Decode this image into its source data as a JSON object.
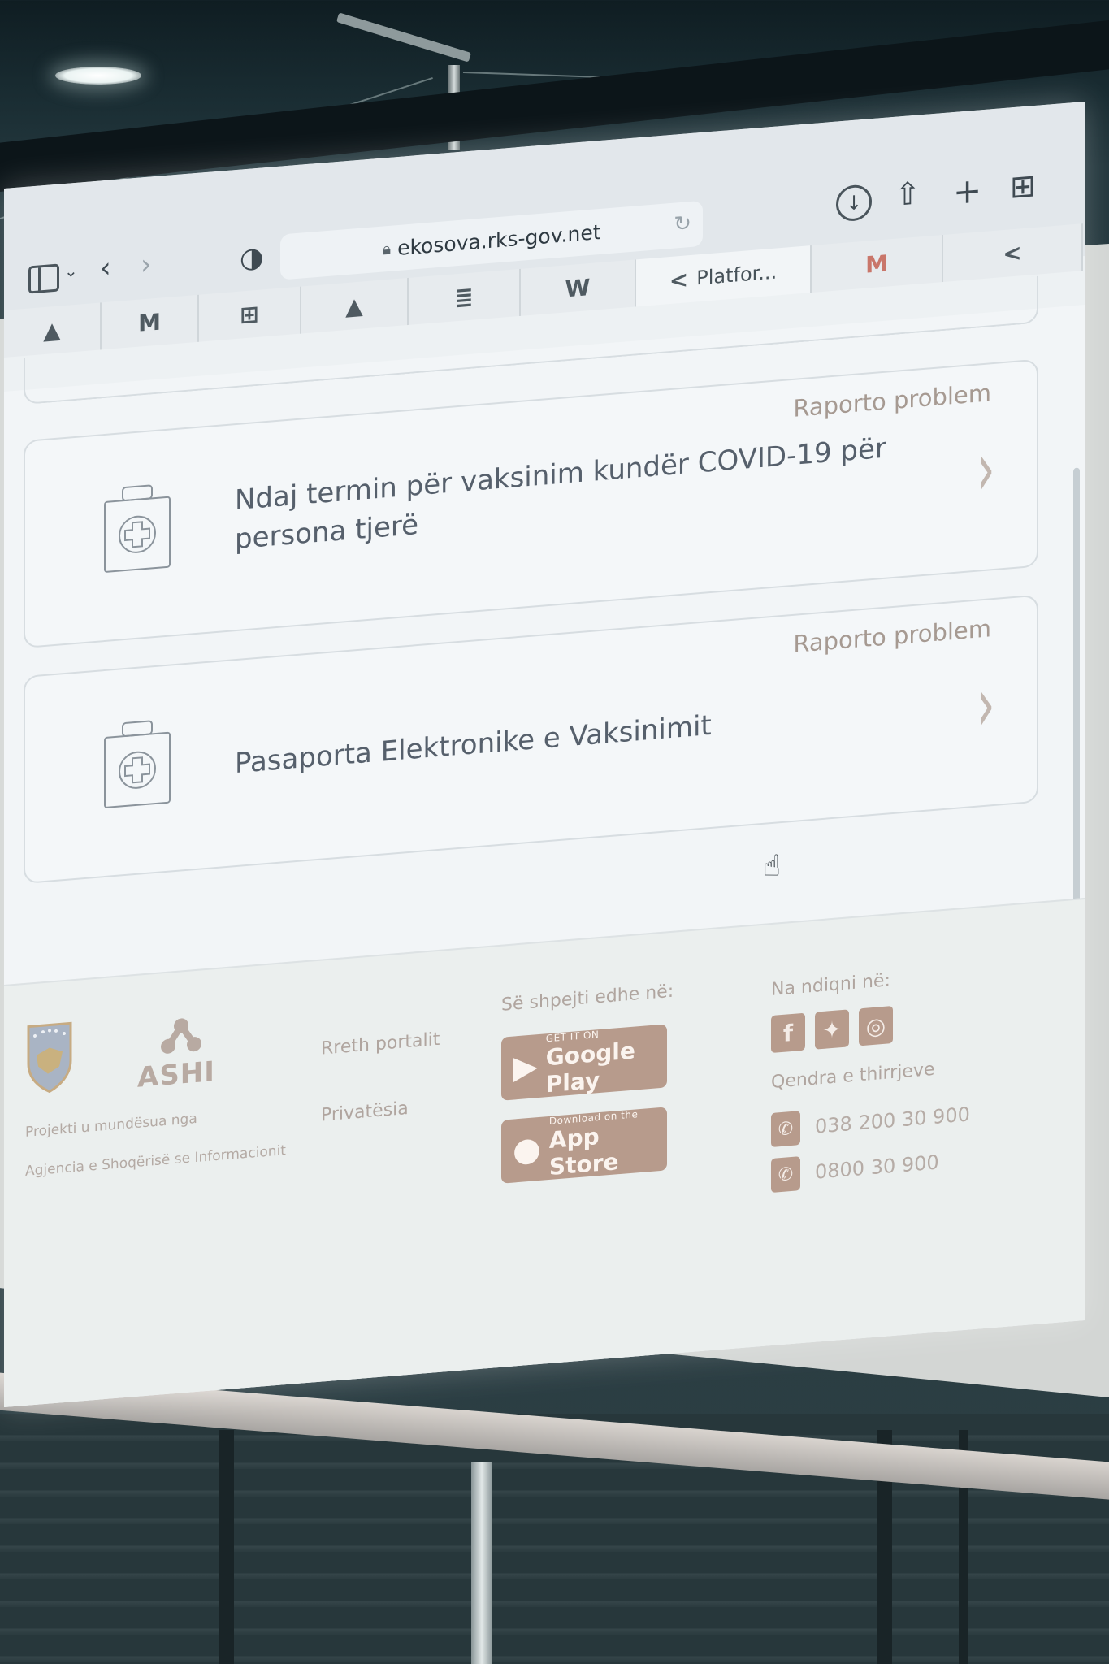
{
  "browser": {
    "url": "ekosova.rks-gov.net",
    "tabs": [
      {
        "icon": "google-drive-icon",
        "glyph": "▲",
        "label": ""
      },
      {
        "icon": "gmail-icon",
        "glyph": "M",
        "label": ""
      },
      {
        "icon": "calculator-icon",
        "glyph": "⊞",
        "label": ""
      },
      {
        "icon": "google-drive-icon",
        "glyph": "▲",
        "label": ""
      },
      {
        "icon": "google-docs-icon",
        "glyph": "≣",
        "label": ""
      },
      {
        "icon": "wordpress-icon",
        "glyph": "W",
        "label": ""
      },
      {
        "icon": "share-node-icon",
        "glyph": "<",
        "label": "Platfor..."
      },
      {
        "icon": "gmail-icon",
        "glyph": "M",
        "label": ""
      },
      {
        "icon": "share-node-icon",
        "glyph": "<",
        "label": ""
      }
    ]
  },
  "services": [
    {
      "report": "Raporto problem",
      "title": "Ndaj termin për vaksinim kundër COVID-19 për persona tjerë"
    },
    {
      "report": "Raporto problem",
      "title": "Pasaporta Elektronike e Vaksinimit"
    }
  ],
  "footer": {
    "org_logo_text": "ASHI",
    "credit_line1": "Projekti u mundësua nga",
    "credit_line2": "Agjencia e Shoqërisë se Informacionit",
    "links": [
      "Rreth portalit",
      "Privatësia"
    ],
    "apps_heading": "Së shpejti edhe në:",
    "google_play": {
      "small": "GET IT ON",
      "big": "Google Play"
    },
    "app_store": {
      "small": "Download on the",
      "big": "App Store"
    },
    "follow_heading": "Na ndiqni në:",
    "callcenter_heading": "Qendra e thirrjeve",
    "phones": [
      "038 200 30 900",
      "0800 30 900"
    ]
  },
  "colors": {
    "accent": "#b79b8c",
    "page_bg": "#f2f5f7",
    "card_border": "#d7dde1",
    "card_text": "#56606c"
  }
}
